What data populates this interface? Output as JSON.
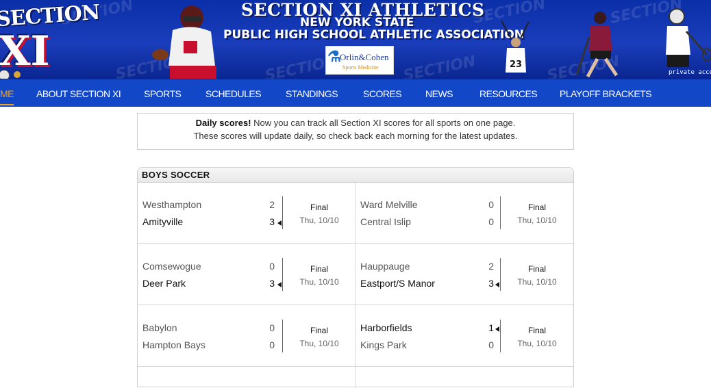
{
  "banner": {
    "logo_top": "SECTION",
    "logo_main": "XI",
    "title": "SECTION XI ATHLETICS",
    "subtitle_1": "NEW YORK STATE",
    "subtitle_2": "PUBLIC HIGH SCHOOL ATHLETIC ASSOCIATION",
    "sponsor_name": "Orlin&Cohen",
    "sponsor_sub": "Sports Medicine",
    "private_access": "private acce",
    "watermark": "SECTION"
  },
  "nav": {
    "items": [
      {
        "label": "ME"
      },
      {
        "label": "ABOUT SECTION XI"
      },
      {
        "label": "SPORTS"
      },
      {
        "label": "SCHEDULES"
      },
      {
        "label": "STANDINGS"
      },
      {
        "label": "SCORES"
      },
      {
        "label": "NEWS"
      },
      {
        "label": "RESOURCES"
      },
      {
        "label": "PLAYOFF BRACKETS"
      }
    ]
  },
  "notice": {
    "bold": "Daily scores!",
    "line1_rest": " Now you can track all Section XI scores for all sports on one page.",
    "line2": "These scores will update daily, so check back each morning for the latest updates."
  },
  "scores": {
    "section_title": "BOYS SOCCER",
    "games": [
      {
        "away": "Westhampton",
        "away_score": "2",
        "home": "Amityville",
        "home_score": "3",
        "winner": "home",
        "status": "Final",
        "date": "Thu, 10/10"
      },
      {
        "away": "Ward Melville",
        "away_score": "0",
        "home": "Central Islip",
        "home_score": "0",
        "winner": "none",
        "status": "Final",
        "date": "Thu, 10/10"
      },
      {
        "away": "Comsewogue",
        "away_score": "0",
        "home": "Deer Park",
        "home_score": "3",
        "winner": "home",
        "status": "Final",
        "date": "Thu, 10/10"
      },
      {
        "away": "Hauppauge",
        "away_score": "2",
        "home": "Eastport/S Manor",
        "home_score": "3",
        "winner": "home",
        "status": "Final",
        "date": "Thu, 10/10"
      },
      {
        "away": "Babylon",
        "away_score": "0",
        "home": "Hampton Bays",
        "home_score": "0",
        "winner": "none",
        "status": "Final",
        "date": "Thu, 10/10"
      },
      {
        "away": "Harborfields",
        "away_score": "1",
        "home": "Kings Park",
        "home_score": "0",
        "winner": "away",
        "status": "Final",
        "date": "Thu, 10/10"
      }
    ]
  },
  "colors": {
    "banner_blue": "#1a3dbb",
    "nav_blue": "#1247c7",
    "active_nav": "#f3a21d"
  }
}
